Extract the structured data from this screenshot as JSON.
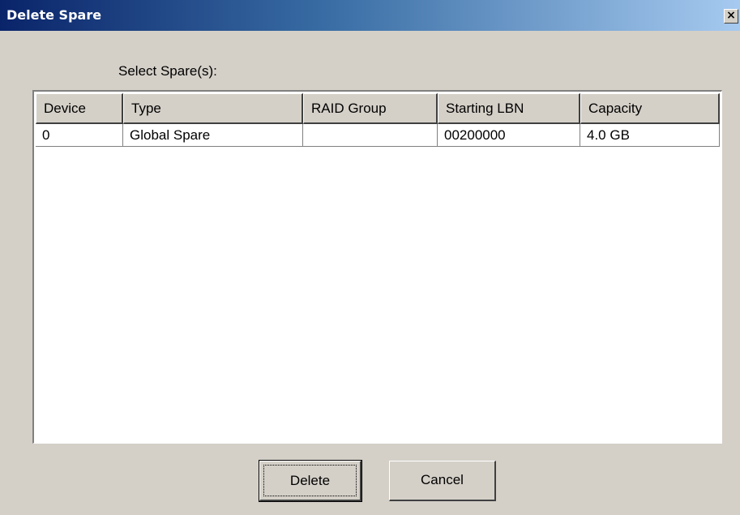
{
  "window": {
    "title": "Delete Spare",
    "close_glyph": "×"
  },
  "select_label": "Select Spare(s):",
  "table": {
    "columns": [
      "Device",
      "Type",
      "RAID Group",
      "Starting LBN",
      "Capacity"
    ],
    "rows": [
      [
        "0",
        "Global Spare",
        "",
        "00200000",
        "4.0 GB"
      ]
    ]
  },
  "buttons": {
    "delete": "Delete",
    "cancel": "Cancel"
  },
  "icons": {
    "close": "close-icon"
  },
  "colors": {
    "titlebar_start": "#0a246a",
    "titlebar_end": "#a6caf0",
    "dialog_bg": "#d4d0c8"
  }
}
